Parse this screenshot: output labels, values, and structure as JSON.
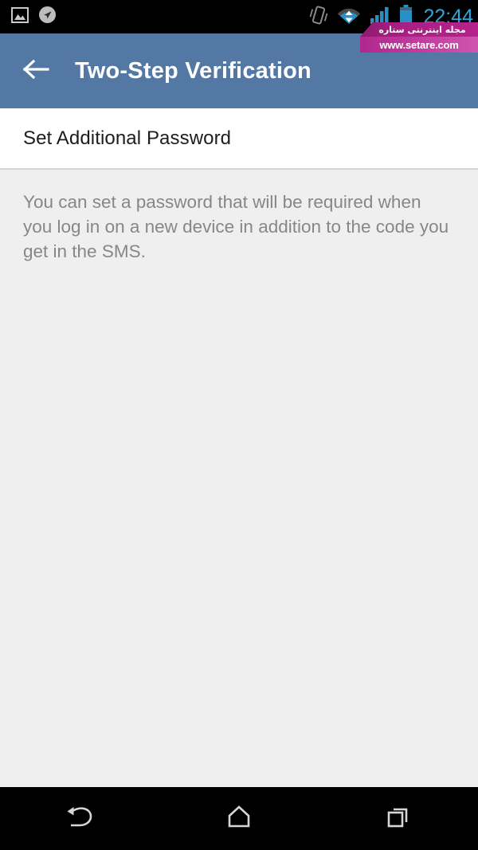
{
  "status_bar": {
    "left_icons": [
      {
        "name": "screenshot-image-icon",
        "label": "image"
      },
      {
        "name": "location-arrow-icon",
        "label": "location"
      }
    ],
    "right_icons": [
      {
        "name": "vibrate-icon",
        "label": "vibrate"
      },
      {
        "name": "wifi-icon",
        "label": "wifi"
      },
      {
        "name": "cellular-signal-icon",
        "label": "signal"
      },
      {
        "name": "battery-icon",
        "label": "battery"
      }
    ],
    "clock": "22:44",
    "clock_color": "#2aa8e0",
    "background_color": "#000000"
  },
  "watermark": {
    "line1": "مجله اینترنتی ستاره",
    "line2": "www.setare.com",
    "color": "#b5228c"
  },
  "action_bar": {
    "back_icon": "back-arrow-icon",
    "title": "Two-Step Verification",
    "background_color": "#5378a4",
    "title_color": "#ffffff"
  },
  "section": {
    "header_label": "Set Additional Password",
    "header_background": "#ffffff",
    "header_text_color": "#1d1d1d"
  },
  "main": {
    "description": "You can set a password that will be required when you log in on a new device in addition to the code you get in the SMS.",
    "background_color": "#efefef",
    "text_color": "#878787"
  },
  "nav_bar": {
    "buttons": [
      {
        "name": "nav-back-button",
        "label": "Back"
      },
      {
        "name": "nav-home-button",
        "label": "Home"
      },
      {
        "name": "nav-recents-button",
        "label": "Recents"
      }
    ],
    "background_color": "#000000"
  }
}
